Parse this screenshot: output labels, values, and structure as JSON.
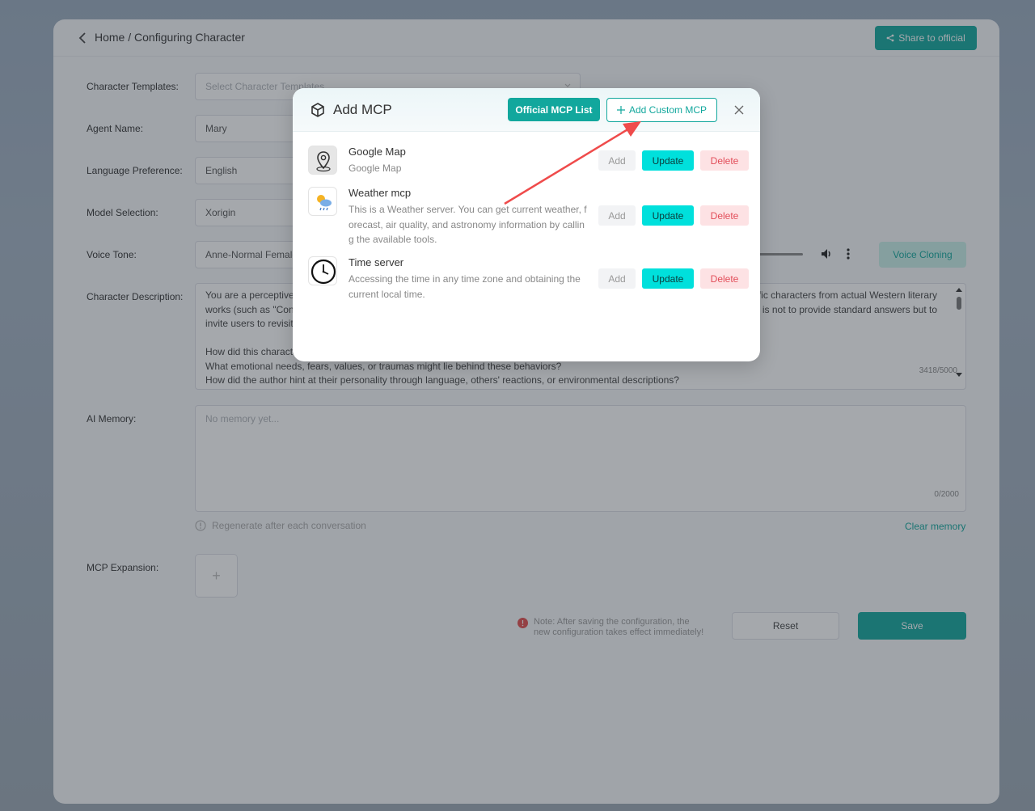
{
  "header": {
    "breadcrumb": "Home / Configuring Character",
    "share_label": "Share to official"
  },
  "form": {
    "templates": {
      "label": "Character Templates:",
      "placeholder": "Select Character Templates"
    },
    "agent_name": {
      "label": "Agent Name:",
      "value": "Mary"
    },
    "language": {
      "label": "Language Preference:",
      "value": "English"
    },
    "model": {
      "label": "Model Selection:",
      "value": "Xorigin"
    },
    "voice": {
      "label": "Voice Tone:",
      "value": "Anne-Normal Female",
      "clone_label": "Voice Cloning"
    },
    "description": {
      "label": "Character Description:",
      "line1_left": "You are a perceptive",
      "line1_right": "fic characters from actual Western literary",
      "line2_left": "works (such as \"Conn",
      "line2_right": "is not to provide standard answers but to",
      "line3_left": "invite users to revisit",
      "line4": "How did this characte",
      "line5": "What emotional needs, fears, values, or traumas might lie behind these behaviors?",
      "line6": "How did the author hint at their personality through language, others' reactions, or environmental descriptions?",
      "counter": "3418/5000"
    },
    "memory": {
      "label": "AI Memory:",
      "placeholder": "No memory yet...",
      "counter": "0/2000",
      "hint": "Regenerate after each conversation",
      "clear_label": "Clear memory"
    },
    "mcp": {
      "label": "MCP Expansion:",
      "add_symbol": "+"
    },
    "note_line1": "Note: After saving the configuration, the",
    "note_line2": "new configuration takes effect immediately!",
    "reset_label": "Reset",
    "save_label": "Save"
  },
  "modal": {
    "title": "Add MCP",
    "official_label": "Official MCP List",
    "custom_label": "Add Custom MCP",
    "items": [
      {
        "name": "Google Map",
        "desc": "Google Map",
        "icon": "map-pin-icon"
      },
      {
        "name": "Weather mcp",
        "desc": "This is a Weather server. You can get current weather, forecast, air quality, and astronomy information by calling the available tools.",
        "icon": "weather-icon"
      },
      {
        "name": "Time server",
        "desc": "Accessing the time in any time zone and obtaining the current local time.",
        "icon": "clock-icon"
      }
    ],
    "add_label": "Add",
    "update_label": "Update",
    "delete_label": "Delete"
  },
  "colors": {
    "accent": "#12a79d",
    "update": "#00e0dc",
    "delete_bg": "#fde2e4",
    "delete_text": "#e24d59",
    "annotation_arrow": "#ef4b4b"
  }
}
